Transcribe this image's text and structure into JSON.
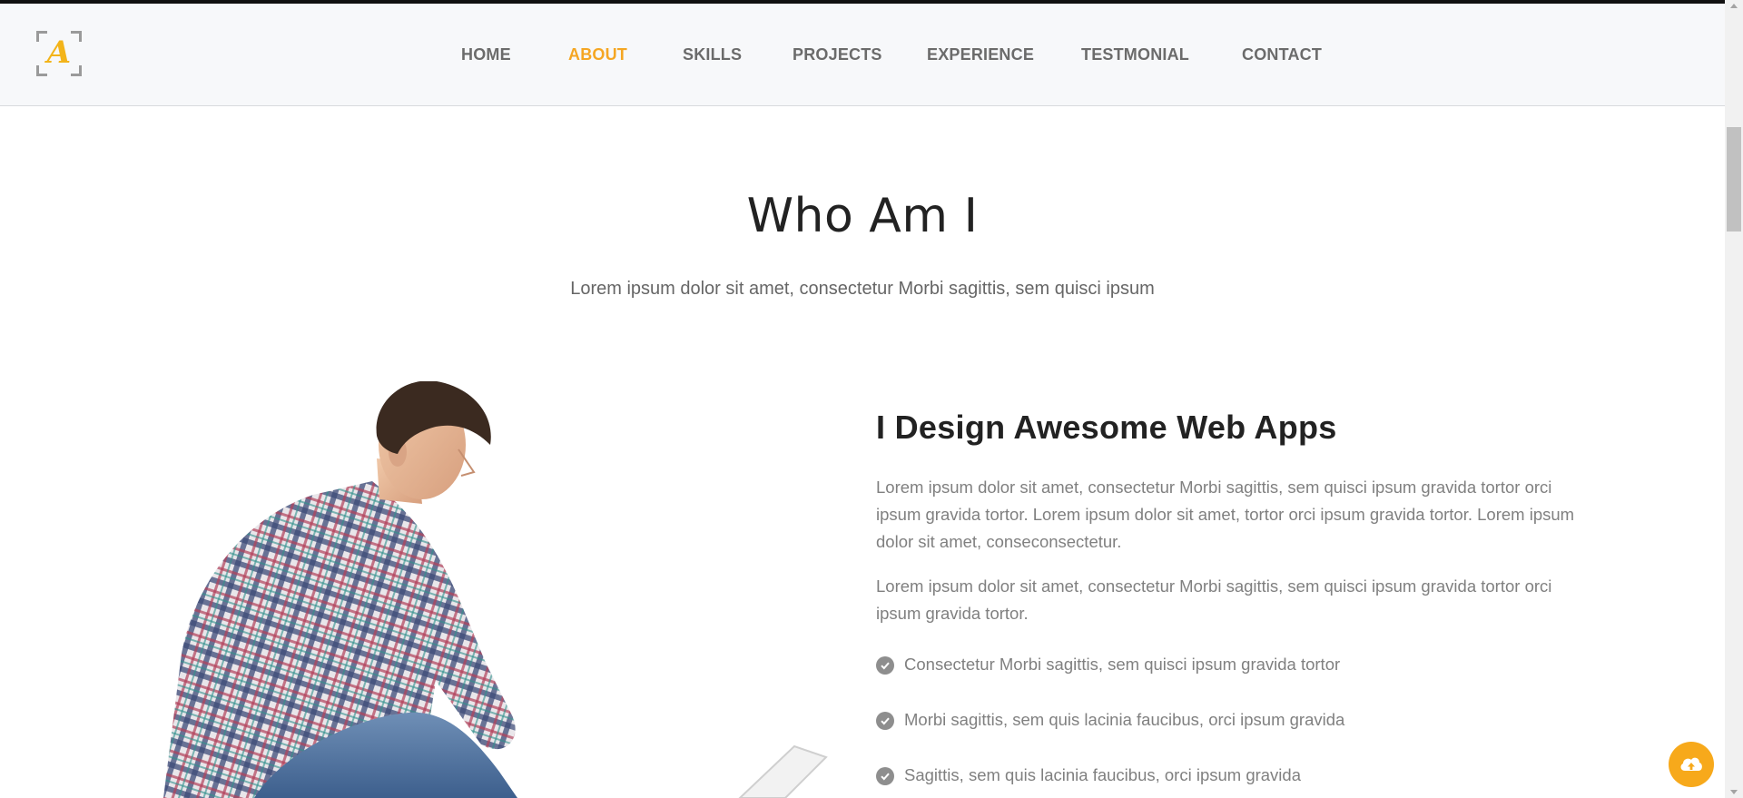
{
  "nav": {
    "logo_letter": "A",
    "items": [
      {
        "label": "HOME",
        "active": false
      },
      {
        "label": "ABOUT",
        "active": true
      },
      {
        "label": "SKILLS",
        "active": false
      },
      {
        "label": "PROJECTS",
        "active": false
      },
      {
        "label": "EXPERIENCE",
        "active": false
      },
      {
        "label": "TESTMONIAL",
        "active": false
      },
      {
        "label": "CONTACT",
        "active": false
      }
    ]
  },
  "about": {
    "title": "Who Am I",
    "subtitle": "Lorem ipsum dolor sit amet, consectetur Morbi sagittis, sem quisci ipsum",
    "heading": "I Design Awesome Web Apps",
    "paragraphs": [
      "Lorem ipsum dolor sit amet, consectetur Morbi sagittis, sem quisci ipsum gravida tortor orci ipsum gravida tortor. Lorem ipsum dolor sit amet, tortor orci ipsum gravida tortor. Lorem ipsum dolor sit amet, conseconsectetur.",
      "Lorem ipsum dolor sit amet, consectetur Morbi sagittis, sem quisci ipsum gravida tortor orci ipsum gravida tortor."
    ],
    "checklist": [
      "Consectetur Morbi sagittis, sem quisci ipsum gravida tortor",
      "Morbi sagittis, sem quis lacinia faucibus, orci ipsum gravida",
      "Sagittis, sem quis lacinia faucibus, orci ipsum gravida"
    ]
  },
  "colors": {
    "accent": "#f5a623",
    "nav_text": "#6b6b6b",
    "body_text": "#808080",
    "heading": "#222222"
  },
  "icons": {
    "check": "check-circle-icon",
    "back_to_top": "cloud-upload-icon"
  }
}
